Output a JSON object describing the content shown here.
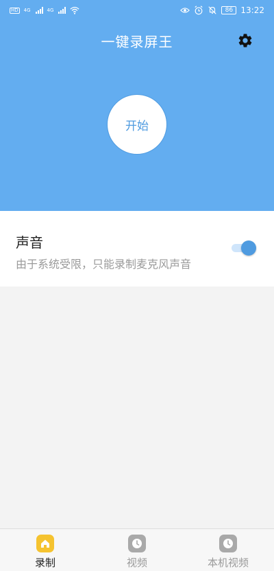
{
  "status_bar": {
    "network_1": "4G",
    "network_2": "4G",
    "battery": "86",
    "time": "13:22"
  },
  "header": {
    "title": "一键录屏王",
    "settings_icon": "gear-icon",
    "start_label": "开始",
    "background_color": "#63adf0"
  },
  "sound": {
    "title": "声音",
    "description": "由于系统受限，只能录制麦克风声音",
    "enabled": true,
    "accent_color": "#4f9be0"
  },
  "bottom_nav": {
    "items": [
      {
        "label": "录制",
        "icon": "home-icon",
        "active": true
      },
      {
        "label": "视频",
        "icon": "clock-icon",
        "active": false
      },
      {
        "label": "本机视频",
        "icon": "clock-icon",
        "active": false
      }
    ],
    "active_color": "#f5c330"
  }
}
